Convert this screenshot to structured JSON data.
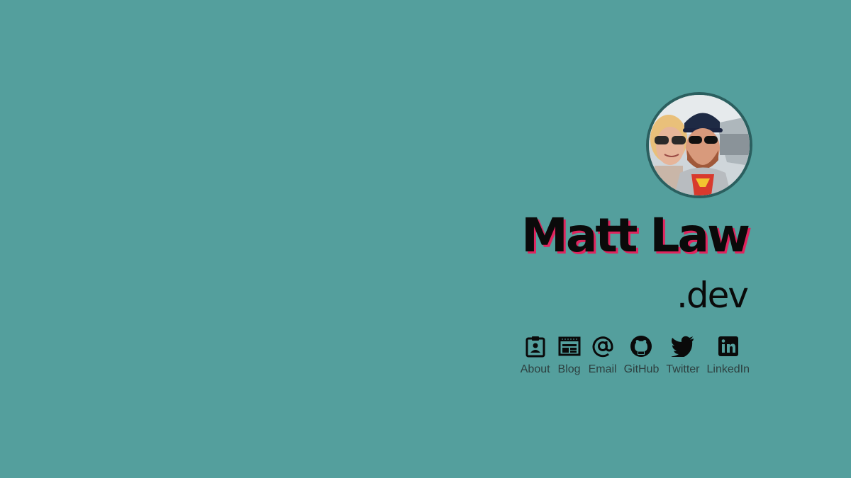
{
  "profile": {
    "name": "Matt Law",
    "tld": ".dev",
    "avatar_alt": "avatar-photo"
  },
  "nav": [
    {
      "label": "About",
      "icon": "contact-card-icon"
    },
    {
      "label": "Blog",
      "icon": "newspaper-icon"
    },
    {
      "label": "Email",
      "icon": "at-sign-icon"
    },
    {
      "label": "GitHub",
      "icon": "github-icon"
    },
    {
      "label": "Twitter",
      "icon": "twitter-icon"
    },
    {
      "label": "LinkedIn",
      "icon": "linkedin-icon"
    }
  ],
  "colors": {
    "background": "#549f9d",
    "name_shadow": "#e0245e",
    "avatar_border": "#2b5f5f",
    "text": "#0a0a0a",
    "nav_label": "#2d3f3f"
  }
}
